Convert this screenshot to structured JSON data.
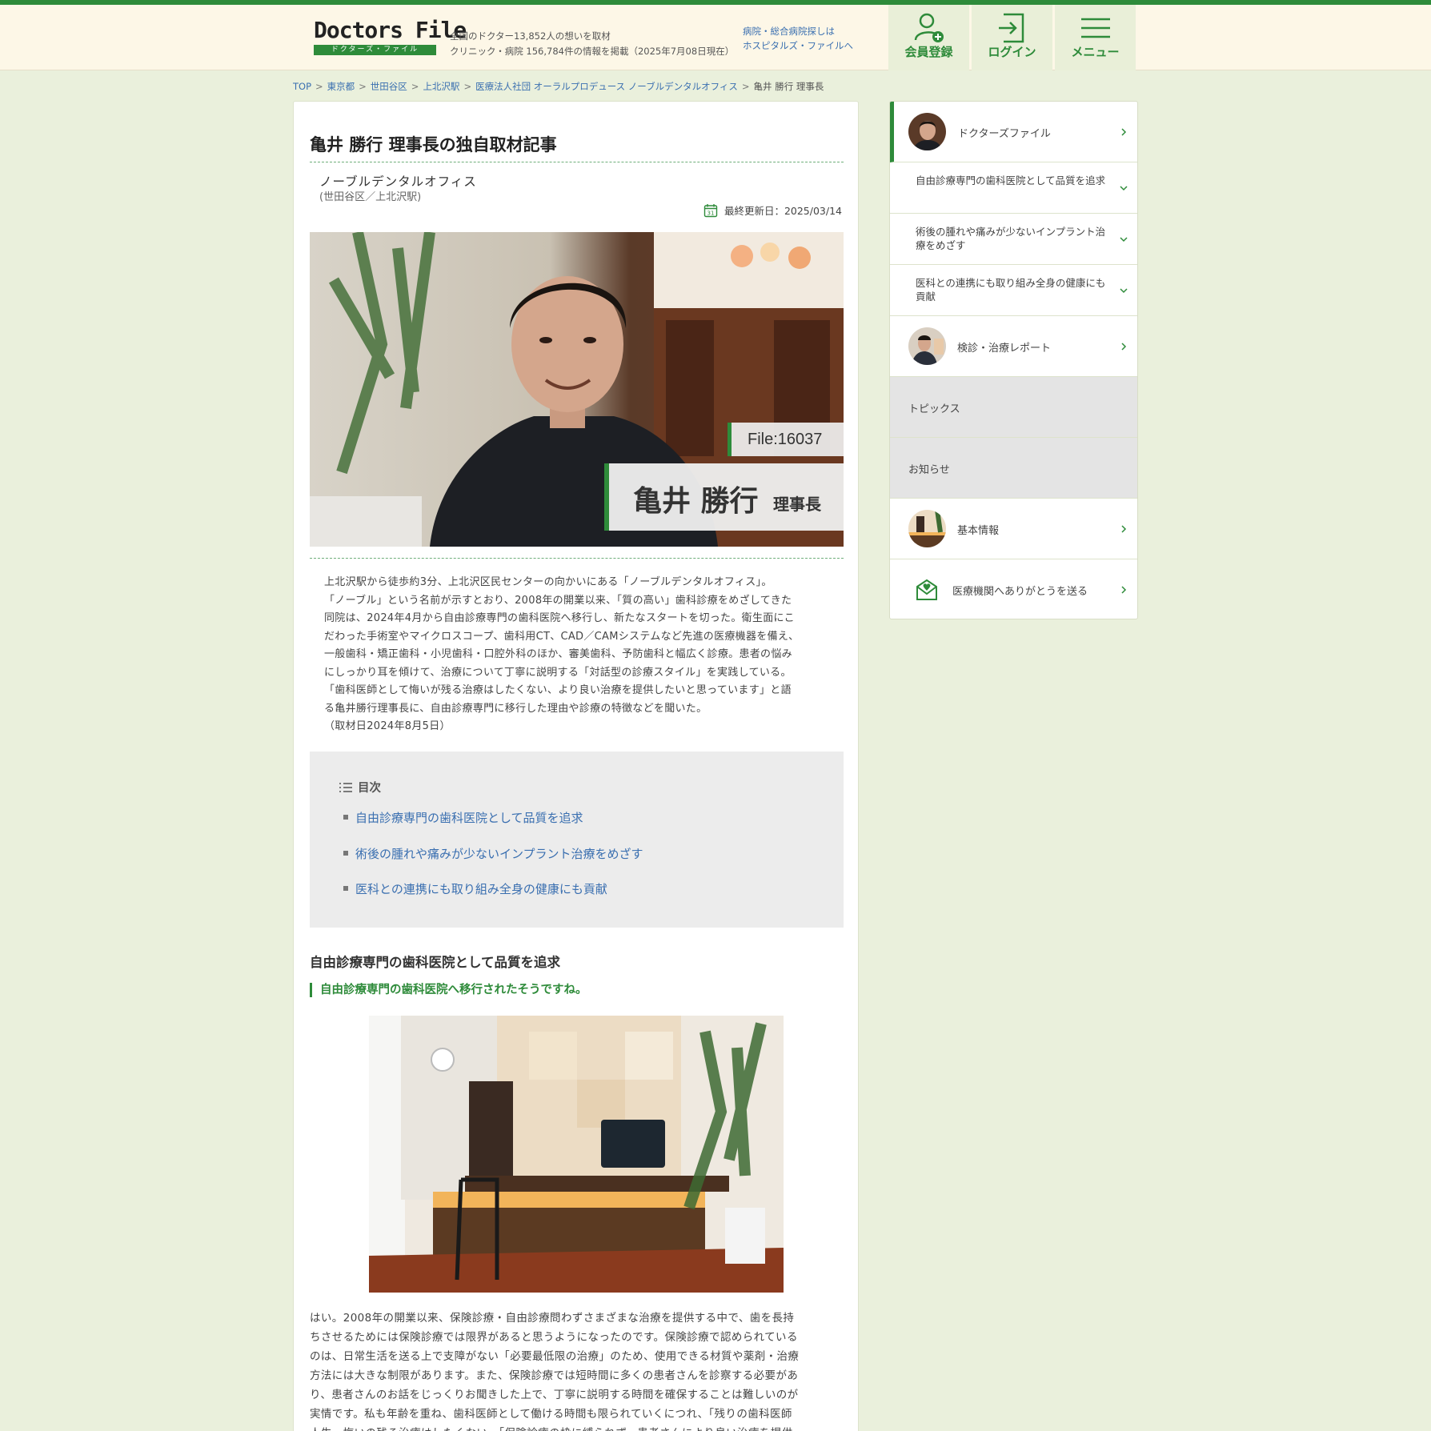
{
  "header": {
    "logo_title": "Doctors File",
    "logo_sub": "ドクターズ・ファイル",
    "tagline_1": "全国のドクター13,852人の想いを取材",
    "tagline_2": "クリニック・病院 156,784件の情報を掲載（2025年7月08日現在）",
    "hospitals_1": "病院・総合病院探しは",
    "hospitals_2": "ホスピタルズ・ファイルへ",
    "register": "会員登録",
    "login": "ログイン",
    "menu": "メニュー"
  },
  "breadcrumb": {
    "top": "TOP",
    "pref": "東京都",
    "ward": "世田谷区",
    "station": "上北沢駅",
    "clinic": "医療法人社団 オーラルプロデュース ノーブルデンタルオフィス",
    "current": "亀井 勝行 理事長",
    "sep": ">"
  },
  "article": {
    "title": "亀井 勝行 理事長の独自取材記事",
    "clinic_name": "ノーブルデンタルオフィス",
    "clinic_area": "(世田谷区／上北沢駅)",
    "updated": "最終更新日：2025/03/14",
    "file_no": "File:16037",
    "doctor_name": "亀井 勝行",
    "doctor_title": "理事長",
    "intro": [
      "上北沢駅から徒歩約3分、上北沢区民センターの向かいにある「ノーブルデンタルオフィス」。",
      "「ノーブル」という名前が示すとおり、2008年の開業以来、「質の高い」歯科診療をめざしてきた",
      "同院は、2024年4月から自由診療専門の歯科医院へ移行し、新たなスタートを切った。衛生面にこ",
      "だわった手術室やマイクロスコープ、歯科用CT、CAD／CAMシステムなど先進の医療機器を備え、",
      "一般歯科・矯正歯科・小児歯科・口腔外科のほか、審美歯科、予防歯科と幅広く診療。患者の悩み",
      "にしっかり耳を傾けて、治療について丁寧に説明する「対話型の診療スタイル」を実践している。",
      "「歯科医師として悔いが残る治療はしたくない、より良い治療を提供したいと思っています」と語",
      "る亀井勝行理事長に、自由診療専門に移行した理由や診療の特徴などを聞いた。",
      "（取材日2024年8月5日）"
    ],
    "toc_title": "目次",
    "toc": [
      "自由診療専門の歯科医院として品質を追求",
      "術後の腫れや痛みが少ないインプラント治療をめざす",
      "医科との連携にも取り組み全身の健康にも貢献"
    ],
    "section1_title": "自由診療専門の歯科医院として品質を追求",
    "question1": "自由診療専門の歯科医院へ移行されたそうですね。",
    "body1": [
      "はい。2008年の開業以来、保険診療・自由診療問わずさまざまな治療を提供する中で、歯を長持",
      "ちさせるためには保険診療では限界があると思うようになったのです。保険診療で認められている",
      "のは、日常生活を送る上で支障がない「必要最低限の治療」のため、使用できる材質や薬剤・治療",
      "方法には大きな制限があります。また、保険診療では短時間に多くの患者さんを診察する必要があ",
      "り、患者さんのお話をじっくりお聞きした上で、丁寧に説明する時間を確保することは難しいのが",
      "実情です。私も年齢を重ね、歯科医師として働ける時間も限られていくにつれ、「残りの歯科医師",
      "人生、悔いの残る治療はしたくない。「保険診療の枠に縛られず、患者さんにより良い治療を提供"
    ]
  },
  "sidebar": {
    "doctors_file": "ドクターズファイル",
    "sub1": "自由診療専門の歯科医院として品質を追求",
    "sub2": "術後の腫れや痛みが少ないインプラント治療をめざす",
    "sub3": "医科との連携にも取り組み全身の健康にも貢献",
    "report": "検診・治療レポート",
    "topics": "トピックス",
    "news": "お知らせ",
    "basic": "基本情報",
    "thanks": "医療機関へありがとうを送る"
  },
  "colors": {
    "accent": "#2e8b3a",
    "link": "#3a6fb0",
    "page_bg": "#eaf0dc",
    "header_bg": "#fdf7e7"
  },
  "icons": {
    "register": "user-plus-icon",
    "login": "login-icon",
    "menu": "hamburger-icon",
    "calendar": "calendar-icon",
    "toc": "list-icon",
    "thanks": "envelope-heart-icon",
    "chevron_right": "chevron-right-icon",
    "chevron_down": "chevron-down-icon"
  }
}
